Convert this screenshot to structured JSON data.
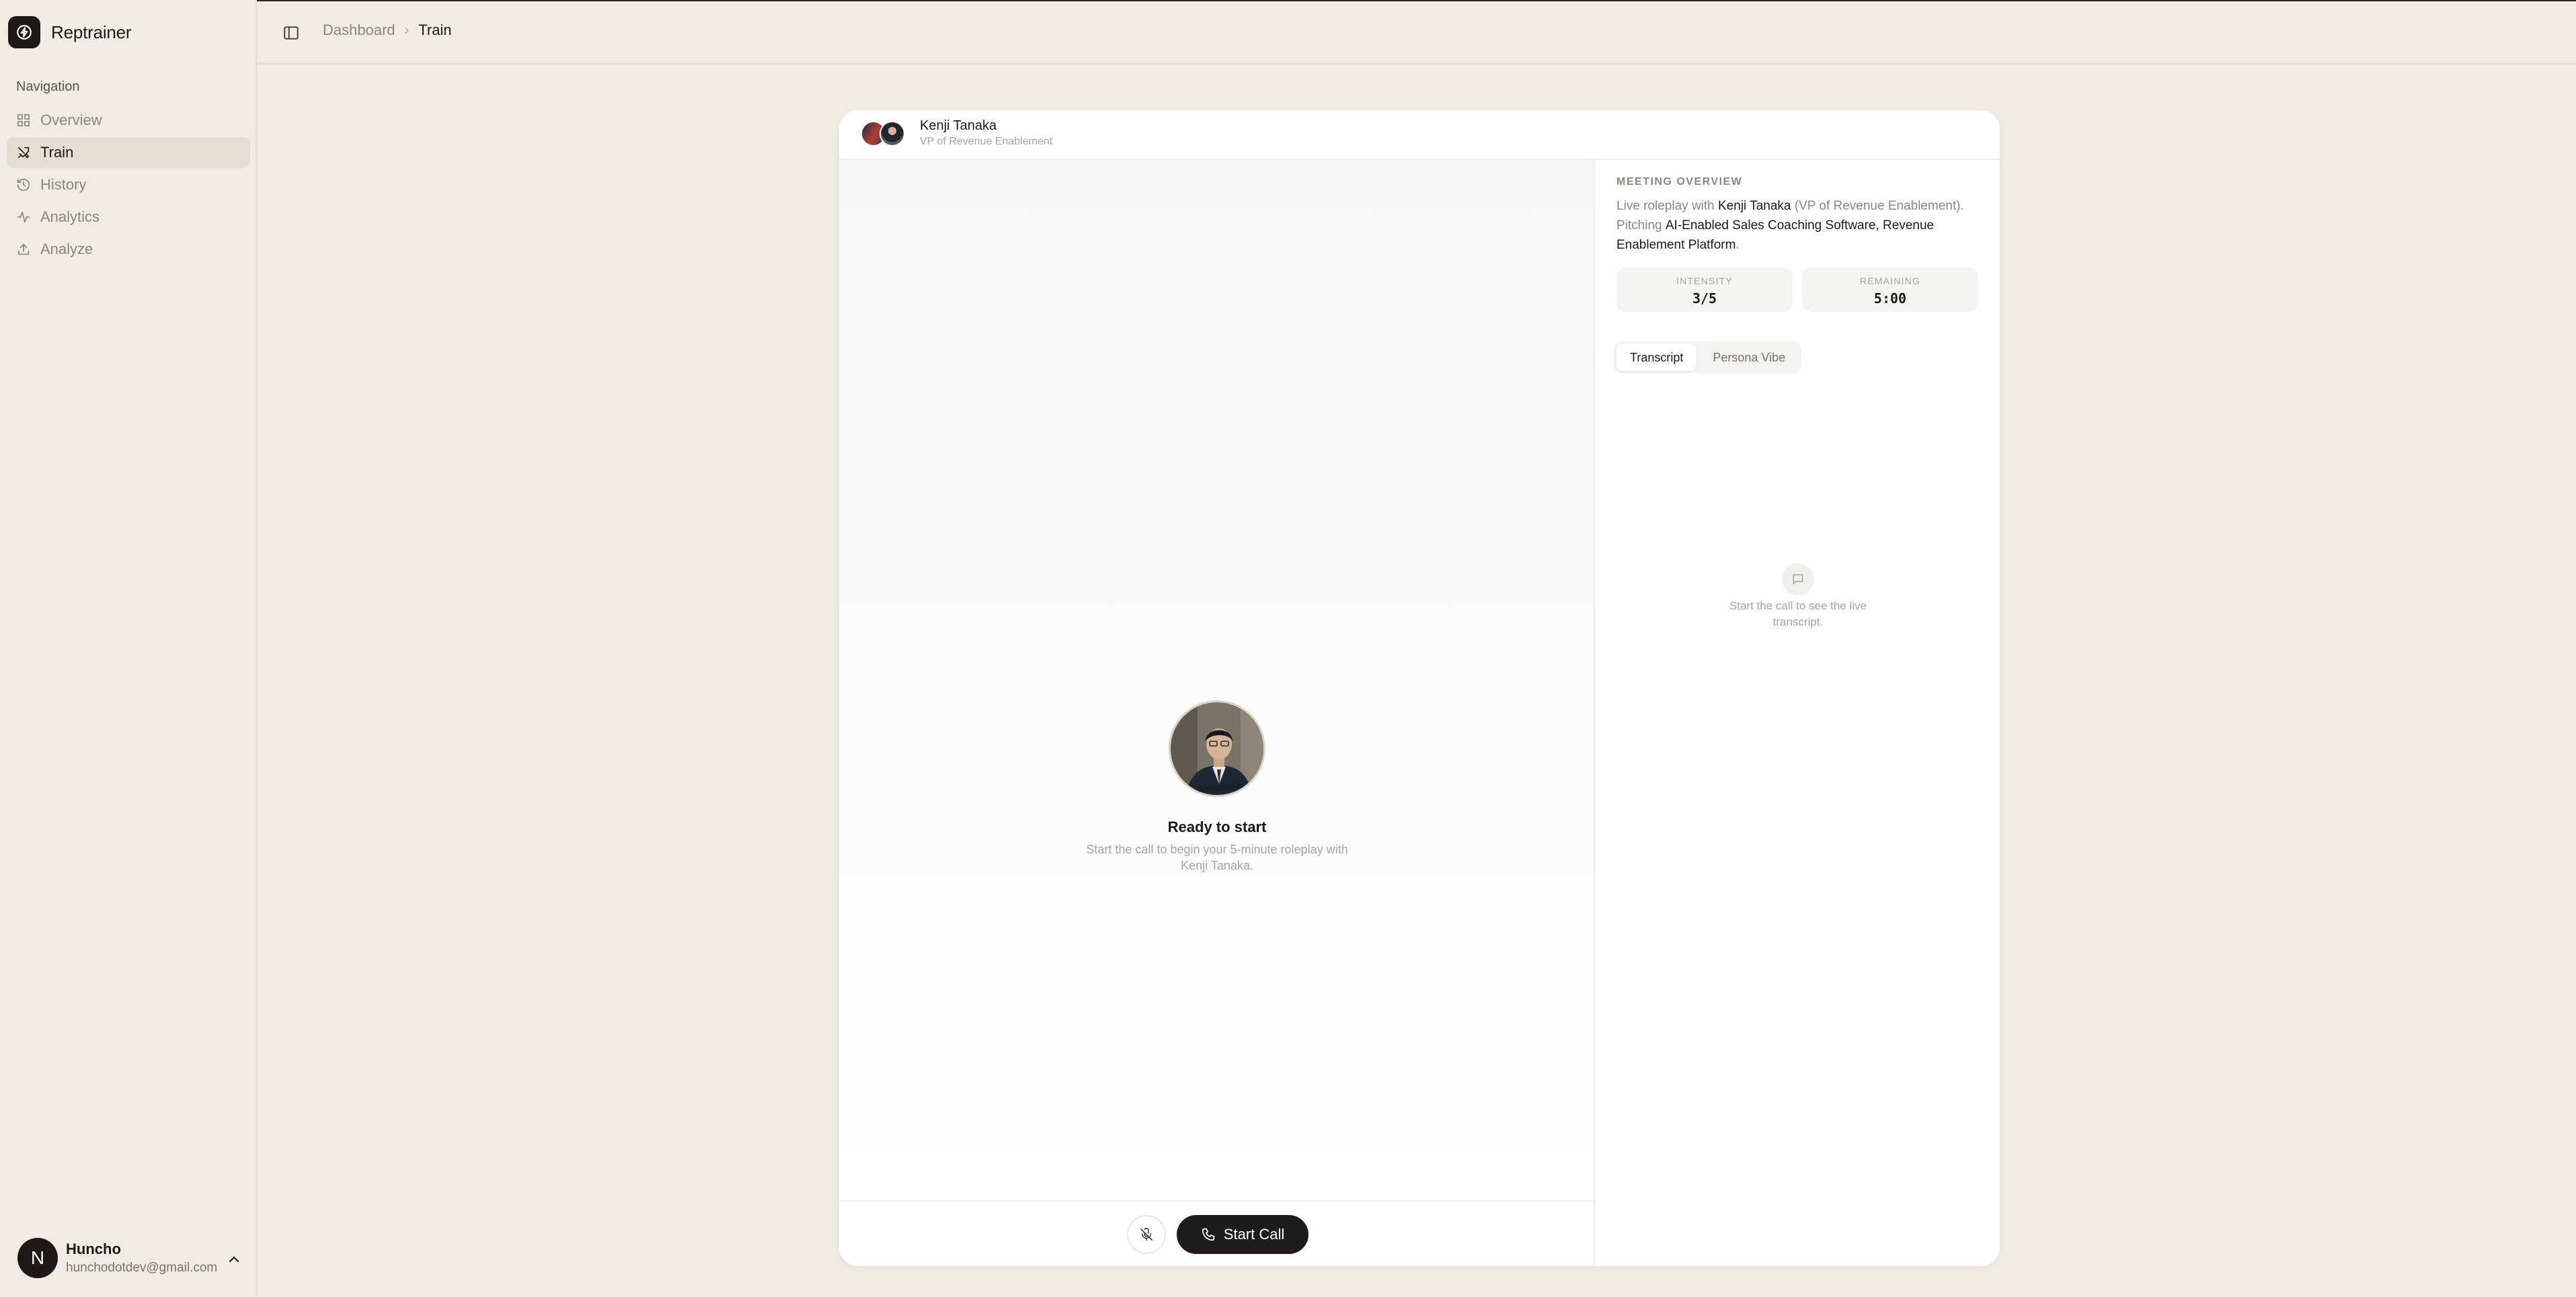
{
  "app": {
    "name": "Reptrainer"
  },
  "sidebar": {
    "heading": "Navigation",
    "items": [
      {
        "label": "Overview",
        "icon": "grid-icon",
        "active": false
      },
      {
        "label": "Train",
        "icon": "swords-icon",
        "active": true
      },
      {
        "label": "History",
        "icon": "history-icon",
        "active": false
      },
      {
        "label": "Analytics",
        "icon": "activity-icon",
        "active": false
      },
      {
        "label": "Analyze",
        "icon": "upload-icon",
        "active": false
      }
    ],
    "user": {
      "initial": "N",
      "name": "Huncho",
      "email": "hunchodotdev@gmail.com"
    }
  },
  "header": {
    "breadcrumb": [
      "Dashboard",
      "Train"
    ]
  },
  "session": {
    "persona_name": "Kenji Tanaka",
    "persona_role": "VP of Revenue Enablement",
    "ready_title": "Ready to start",
    "ready_subtitle": "Start the call to begin your 5-minute roleplay with Kenji Tanaka.",
    "start_call_label": "Start Call"
  },
  "overview": {
    "label": "MEETING OVERVIEW",
    "text_prefix": "Live roleplay with ",
    "persona_name": "Kenji Tanaka",
    "role_paren": " (VP of Revenue Enablement). Pitching ",
    "products": "AI-Enabled Sales Coaching Software, Revenue Enablement Platform",
    "text_suffix": ".",
    "intensity_label": "INTENSITY",
    "intensity_value": "3/5",
    "remaining_label": "REMAINING",
    "remaining_value": "5:00"
  },
  "tabs": [
    "Transcript",
    "Persona Vibe"
  ],
  "transcript": {
    "empty_text": "Start the call to see the live transcript."
  },
  "colors": {
    "background": "#f0ebe4",
    "accent": "#1c1917",
    "active_nav": "#e6ddd2"
  }
}
